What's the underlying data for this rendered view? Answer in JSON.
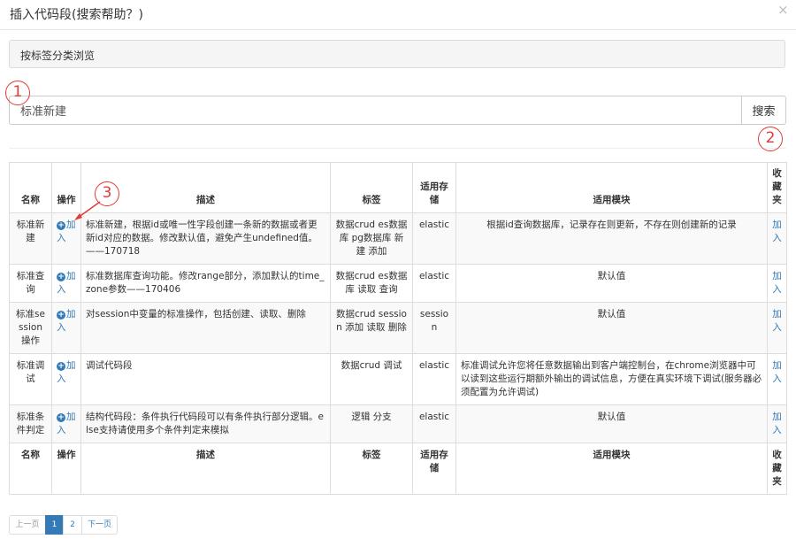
{
  "modal": {
    "title": "插入代码段(搜索帮助？)",
    "close_glyph": "×"
  },
  "tag_browse": {
    "label": "按标签分类浏览"
  },
  "search": {
    "value": "标准新建",
    "button_label": "搜索"
  },
  "table": {
    "headers": {
      "name": "名称",
      "action": "操作",
      "desc": "描述",
      "tags": "标签",
      "store": "适用存储",
      "module": "适用模块",
      "fav": "收藏夹"
    },
    "rows": [
      {
        "name": "标准新建",
        "action": "加入",
        "desc": "标准新建，根据id或唯一性字段创建一条新的数据或者更新id对应的数据。修改默认值，避免产生undefined值。——170718",
        "tags": "数据crud es数据库 pg数据库 新建 添加",
        "store": "elastic",
        "module": "根据id查询数据库，记录存在则更新，不存在则创建新的记录",
        "fav": "加入"
      },
      {
        "name": "标准查询",
        "action": "加入",
        "desc": "标准数据库查询功能。修改range部分，添加默认的time_zone参数——170406",
        "tags": "数据crud es数据库 读取 查询",
        "store": "elastic",
        "module": "默认值",
        "fav": "加入"
      },
      {
        "name": "标准session操作",
        "action": "加入",
        "desc": "对session中变量的标准操作，包括创建、读取、删除",
        "tags": "数据crud session 添加 读取 删除",
        "store": "session",
        "module": "默认值",
        "fav": "加入"
      },
      {
        "name": "标准调试",
        "action": "加入",
        "desc": "调试代码段",
        "tags": "数据crud 调试",
        "store": "elastic",
        "module": "标准调试允许您将任意数据输出到客户端控制台，在chrome浏览器中可以读到这些运行期额外输出的调试信息，方便在真实环境下调试(服务器必须配置为允许调试)",
        "fav": "加入"
      },
      {
        "name": "标准条件判定",
        "action": "加入",
        "desc": "结构代码段：条件执行代码段可以有条件执行部分逻辑。else支持请使用多个条件判定来模拟",
        "tags": "逻辑 分支",
        "store": "elastic",
        "module": "默认值",
        "fav": "加入"
      }
    ]
  },
  "pagination": {
    "prev": "上一页",
    "pages": [
      "1",
      "2"
    ],
    "next": "下一页",
    "current": "1"
  },
  "annotations": {
    "a1": "1",
    "a2": "2",
    "a3": "3",
    "color": "#e53935"
  },
  "colors": {
    "link": "#337ab7",
    "active_page": "#337ab7"
  }
}
